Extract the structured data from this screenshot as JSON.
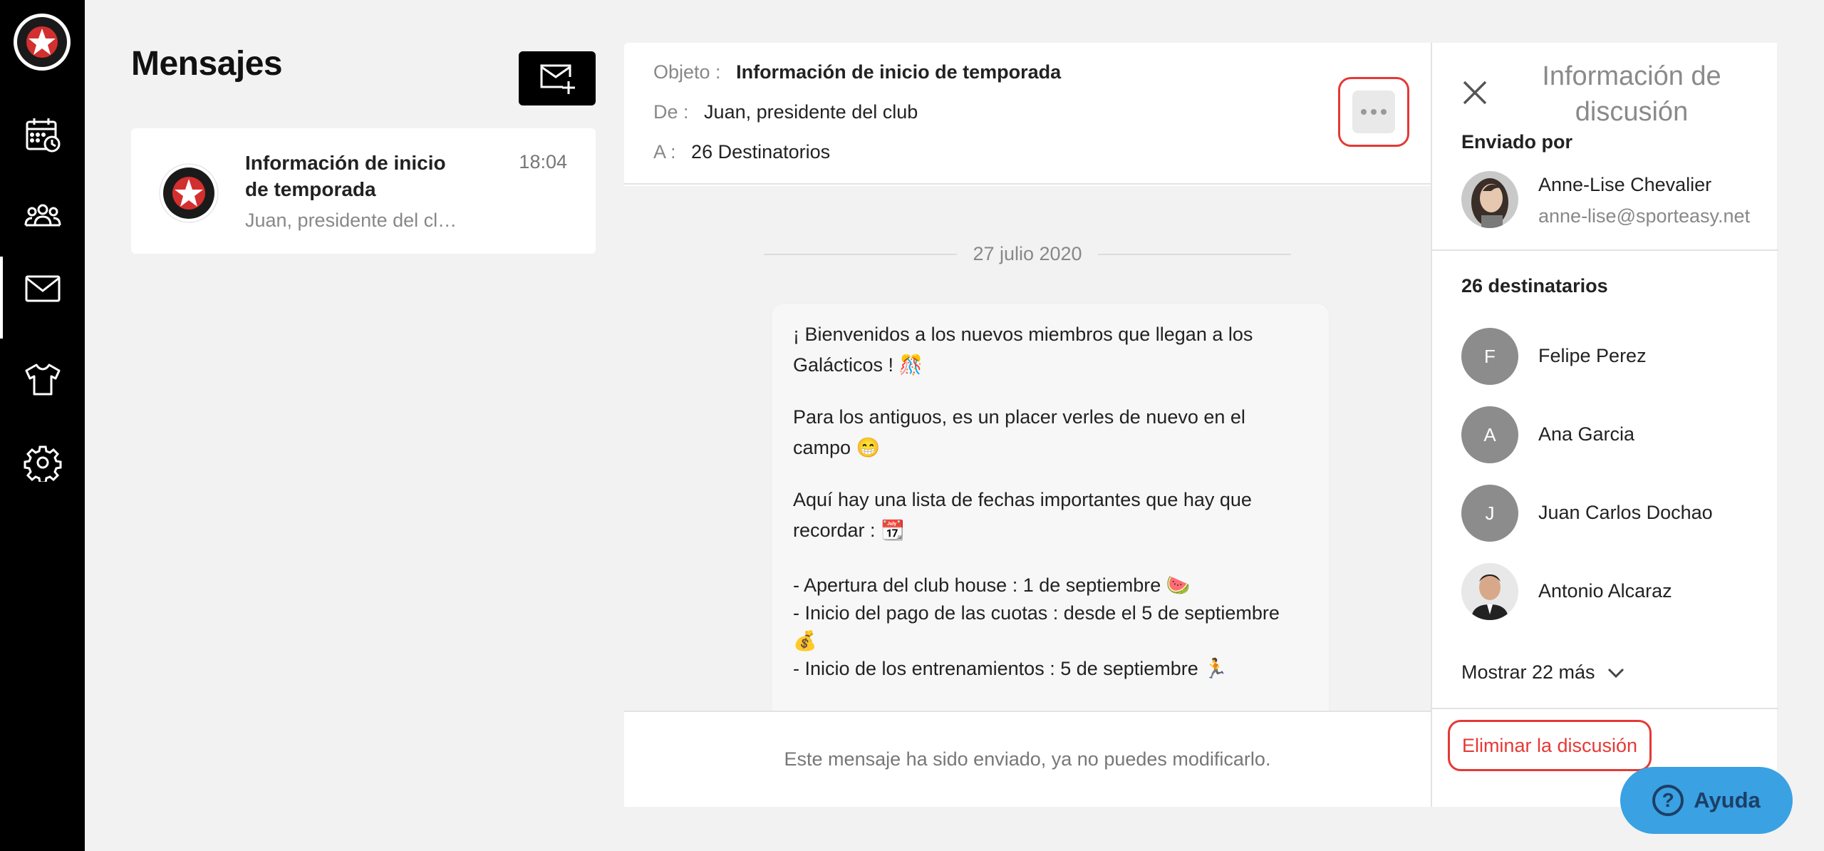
{
  "sidebar": {
    "items": [
      {
        "name": "calendar-icon"
      },
      {
        "name": "team-icon"
      },
      {
        "name": "mail-icon",
        "active": true
      },
      {
        "name": "shirt-icon"
      },
      {
        "name": "settings-icon"
      }
    ]
  },
  "messages": {
    "title": "Mensajes",
    "list": [
      {
        "title": "Información de inicio de temporada",
        "time": "18:04",
        "preview": "Juan, presidente del club"
      }
    ]
  },
  "conversation": {
    "subject_label": "Objeto :",
    "subject": "Información de inicio de temporada",
    "from_label": "De :",
    "from": "Juan, presidente del club",
    "to_label": "A :",
    "to": "26 Destinatorios",
    "date": "27 julio 2020",
    "message": {
      "p1": "¡ Bienvenidos a los nuevos miembros que llegan a los Galácticos ! 🎊",
      "p2": "Para los antiguos, es un placer verles de nuevo en el campo 😁",
      "p3": "Aquí hay una lista de fechas importantes que hay que recordar : 📆",
      "l1": "- Apertura del club house : 1 de septiembre 🍉",
      "l2": "- Inicio del pago de las cuotas : desde el 5 de septiembre 💰",
      "l3": "- Inicio de los entrenamientos : 5 de septiembre 🏃"
    },
    "footer": "Este mensaje ha sido enviado, ya no puedes modificarlo."
  },
  "info_panel": {
    "title": "Información de discusión",
    "sent_by_label": "Enviado por",
    "sender_name": "Anne-Lise Chevalier",
    "sender_email": "anne-lise@sporteasy.net",
    "recipients_label": "26 destinatarios",
    "recipients": [
      {
        "initial": "F",
        "name": "Felipe Perez"
      },
      {
        "initial": "A",
        "name": "Ana Garcia"
      },
      {
        "initial": "J",
        "name": "Juan Carlos Dochao"
      },
      {
        "initial": "",
        "name": "Antonio Alcaraz"
      }
    ],
    "show_more": "Mostrar 22 más",
    "delete": "Eliminar la discusión"
  },
  "help": {
    "label": "Ayuda",
    "symbol": "?"
  },
  "colors": {
    "accent_red": "#e53935",
    "help_blue": "#3aa1e2",
    "sidebar_bg": "#000000"
  }
}
